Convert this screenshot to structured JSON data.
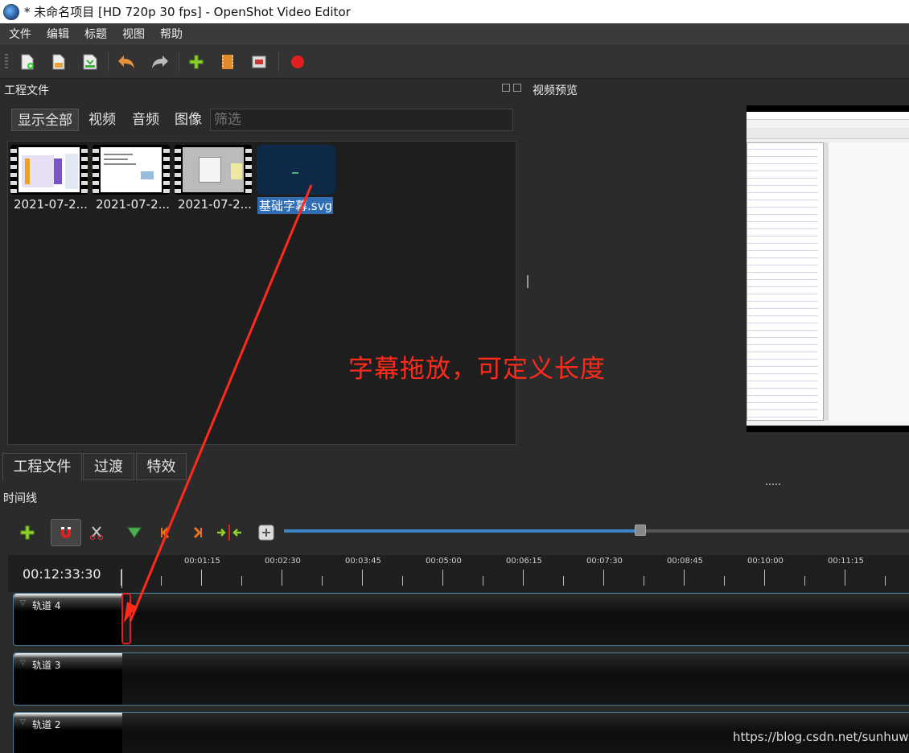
{
  "window": {
    "title": "* 未命名项目 [HD 720p 30 fps] - OpenShot Video Editor"
  },
  "menu": [
    "文件",
    "编辑",
    "标题",
    "视图",
    "帮助"
  ],
  "toolbar": {
    "icons": [
      "new-project-icon",
      "open-project-icon",
      "save-project-icon",
      "undo-icon",
      "redo-icon",
      "import-files-icon",
      "choose-profile-icon",
      "fullscreen-icon",
      "export-video-icon"
    ]
  },
  "project_files": {
    "title": "工程文件",
    "filters": {
      "all": "显示全部",
      "video": "视频",
      "audio": "音频",
      "image": "图像"
    },
    "filter_placeholder": "筛选",
    "files": [
      {
        "label": "2021-07-2..."
      },
      {
        "label": "2021-07-2..."
      },
      {
        "label": "2021-07-2..."
      },
      {
        "label": "基础字幕.svg",
        "selected": true
      }
    ]
  },
  "annotation": "字幕拖放，可定义长度",
  "preview": {
    "title": "视频预览"
  },
  "bottom_tabs": [
    "工程文件",
    "过渡",
    "特效"
  ],
  "timeline": {
    "title": "时间线",
    "current_time": "00:12:33:30",
    "zoom_level": 0.57,
    "ticks": [
      "00:01:15",
      "00:02:30",
      "00:03:45",
      "00:05:00",
      "00:06:15",
      "00:07:30",
      "00:08:45",
      "00:10:00",
      "00:11:15"
    ],
    "tracks": [
      "轨道 4",
      "轨道 3",
      "轨道 2"
    ]
  },
  "watermark": "https://blog.csdn.net/sunhuwh",
  "colors": {
    "accent": "#3b84c8",
    "annotation": "#ff2a1a",
    "selection": "#2f6db5",
    "record": "#e02020"
  }
}
